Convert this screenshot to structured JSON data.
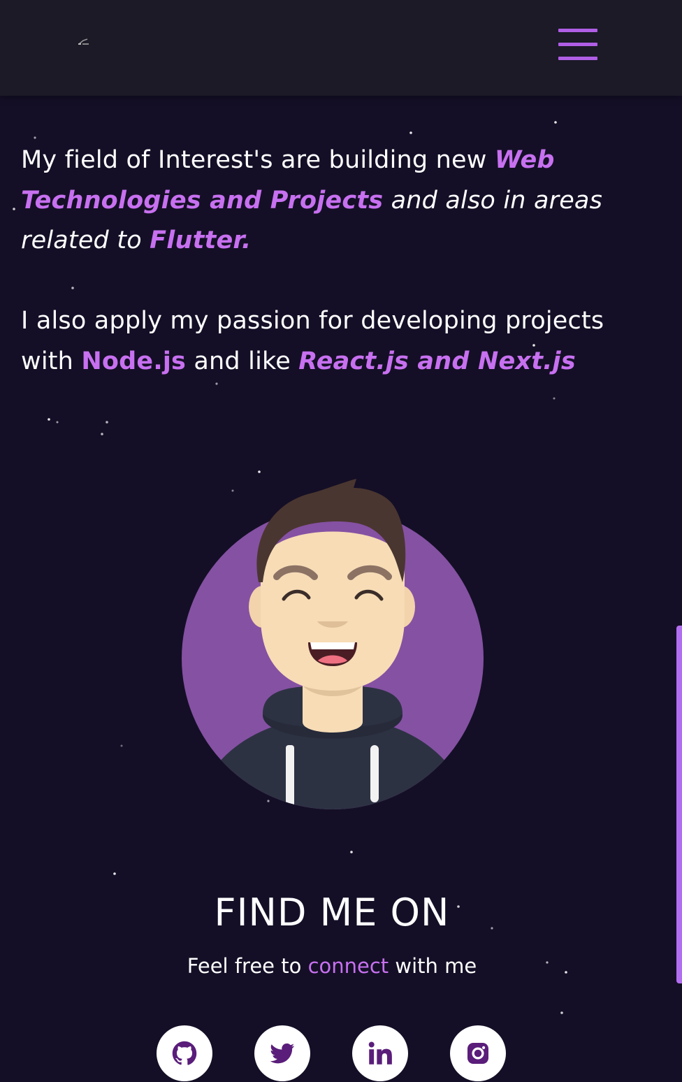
{
  "nav": {
    "logo_icon": "logo-icon",
    "menu_icon": "hamburger-menu-icon"
  },
  "about": {
    "p1": {
      "lead": "My field of Interest's are building new ",
      "hl_web": "Web Technologies and Projects",
      "mid": " and also in areas related to ",
      "hl_flutter": "Flutter."
    },
    "p2": {
      "lead": "I also apply my passion for developing projects with ",
      "hl_node": "Node.js",
      "mid": " and  like ",
      "hl_react": "React.js and Next.js"
    }
  },
  "find": {
    "title": "FIND ME ON",
    "sub_before": "Feel free to ",
    "sub_link": "connect",
    "sub_after": " with me"
  },
  "socials": [
    {
      "icon": "github-icon"
    },
    {
      "icon": "twitter-icon"
    },
    {
      "icon": "linkedin-icon"
    },
    {
      "icon": "instagram-icon"
    }
  ],
  "colors": {
    "background": "#140f26",
    "navbar": "#1b1a26",
    "accent": "#c770f0",
    "menu": "#b05ee6",
    "avatar_circle": "#8551a3",
    "social_icon": "#5a1d7a"
  }
}
